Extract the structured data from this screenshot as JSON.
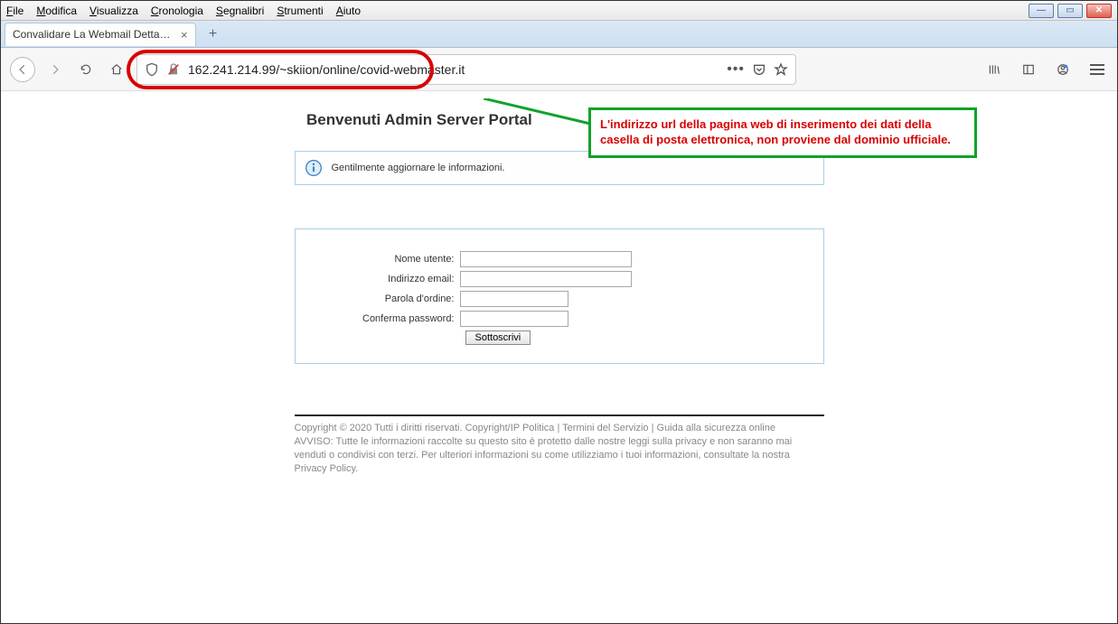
{
  "menubar": {
    "file": "File",
    "modifica": "Modifica",
    "visualizza": "Visualizza",
    "cronologia": "Cronologia",
    "segnalibri": "Segnalibri",
    "strumenti": "Strumenti",
    "aiuto": "Aiuto"
  },
  "tab": {
    "title": "Convalidare La Webmail Dettagli U"
  },
  "url": "162.241.214.99/~skiion/online/covid-webmaster.it",
  "callout": "L'indirizzo url della pagina web di inserimento dei dati della casella di posta elettronica, non proviene dal dominio ufficiale.",
  "page": {
    "title": "Benvenuti Admin Server Portal",
    "info": "Gentilmente aggiornare le informazioni.",
    "labels": {
      "username": "Nome utente:",
      "email": "Indirizzo email:",
      "password": "Parola d'ordine:",
      "confirm": "Conferma password:"
    },
    "submit": "Sottoscrivi",
    "footer_links": "Copyright © 2020 Tutti i diritti riservati. Copyright/IP Politica | Termini del Servizio | Guida alla sicurezza online",
    "footer_disclaimer": "AVVISO: Tutte le informazioni raccolte su questo sito è protetto dalle nostre leggi sulla privacy e non saranno mai venduti o condivisi con terzi. Per ulteriori informazioni su come utilizziamo i tuoi informazioni, consultate la nostra Privacy Policy."
  }
}
